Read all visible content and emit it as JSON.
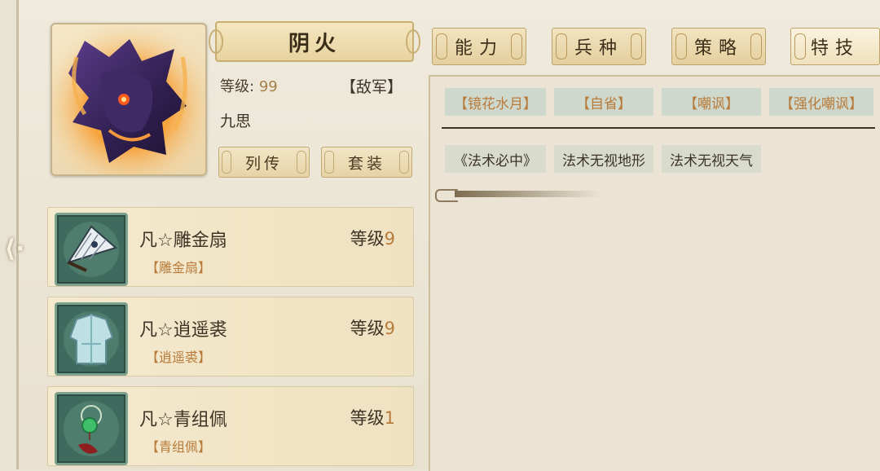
{
  "hero": {
    "name": "阴火",
    "level_label": "等级:",
    "level_value": "99",
    "faction": "【敌军】",
    "general": "九思",
    "buttons": {
      "biography": "列传",
      "set": "套装"
    }
  },
  "equipment": [
    {
      "title": "凡☆雕金扇",
      "subtitle": "【雕金扇】",
      "level_label": "等级",
      "level": "9",
      "icon": "fan-icon"
    },
    {
      "title": "凡☆逍遥裘",
      "subtitle": "【逍遥裘】",
      "level_label": "等级",
      "level": "9",
      "icon": "robe-icon"
    },
    {
      "title": "凡☆青组佩",
      "subtitle": "【青组佩】",
      "level_label": "等级",
      "level": "1",
      "icon": "jade-pendant-icon"
    }
  ],
  "tabs": [
    "能力",
    "兵种",
    "策略",
    "特技"
  ],
  "active_tab": "特技",
  "skills_row1": [
    "【镜花水月】",
    "【自省】",
    "【嘲讽】",
    "【强化嘲讽】"
  ],
  "skills_row2": [
    "《法术必中》",
    "法术无视地形",
    "法术无视天气"
  ],
  "colors": {
    "accent_orange": "#b87b3c",
    "panel_bg": "#ebe4d4",
    "tag_bg": "#cfd8cc"
  }
}
